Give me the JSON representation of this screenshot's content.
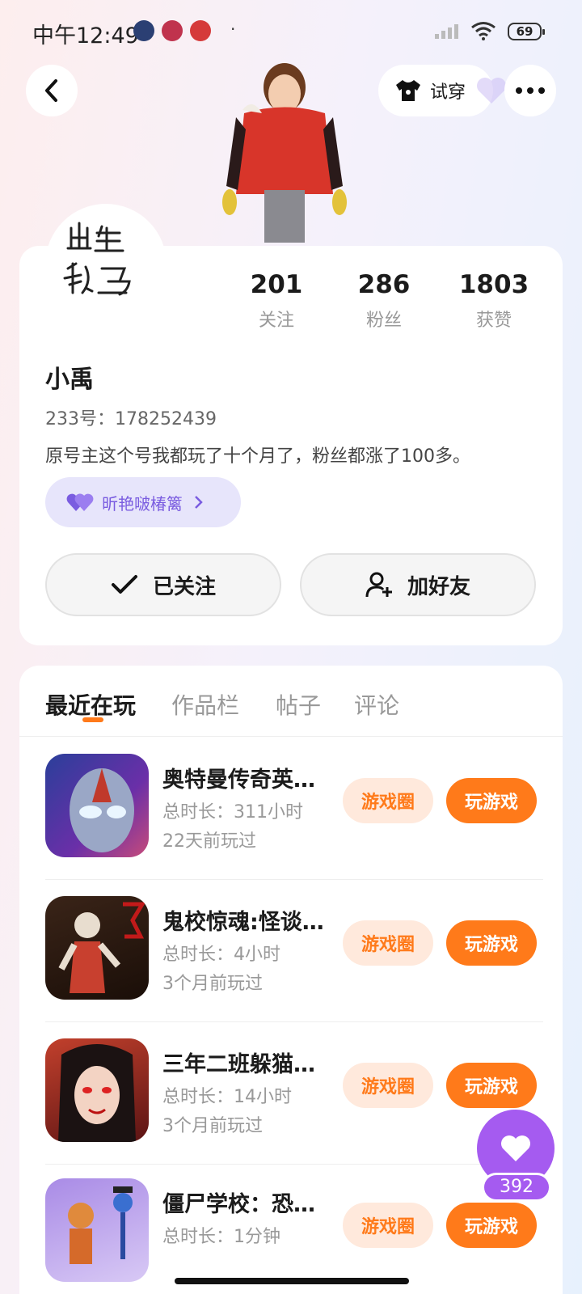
{
  "status_bar": {
    "time": "中午12:49",
    "battery": "69"
  },
  "header": {
    "tryon_label": "试穿"
  },
  "profile": {
    "stats": [
      {
        "value": "201",
        "label": "关注"
      },
      {
        "value": "286",
        "label": "粉丝"
      },
      {
        "value": "1803",
        "label": "获赞"
      }
    ],
    "name": "小禹",
    "uid": "233号：178252439",
    "bio": "原号主这个号我都玩了十个月了，粉丝都涨了100多。",
    "club": "昕艳啵椿篱",
    "followed_label": "已关注",
    "add_friend_label": "加好友"
  },
  "tabs": [
    "最近在玩",
    "作品栏",
    "帖子",
    "评论"
  ],
  "games": [
    {
      "title": "奥特曼传奇英…",
      "duration": "总时长：311小时",
      "last_played": "22天前玩过",
      "circle_label": "游戏圈",
      "play_label": "玩游戏"
    },
    {
      "title": "鬼校惊魂:怪谈…",
      "duration": "总时长：4小时",
      "last_played": "3个月前玩过",
      "circle_label": "游戏圈",
      "play_label": "玩游戏"
    },
    {
      "title": "三年二班躲猫…",
      "duration": "总时长：14小时",
      "last_played": "3个月前玩过",
      "circle_label": "游戏圈",
      "play_label": "玩游戏"
    },
    {
      "title": "僵尸学校：恐…",
      "duration": "总时长：1分钟",
      "last_played": "",
      "circle_label": "游戏圈",
      "play_label": "玩游戏"
    }
  ],
  "like_count": "392",
  "colors": {
    "accent_orange": "#ff7a1a",
    "accent_purple": "#a55bf0",
    "club_text": "#7a5ce0"
  }
}
